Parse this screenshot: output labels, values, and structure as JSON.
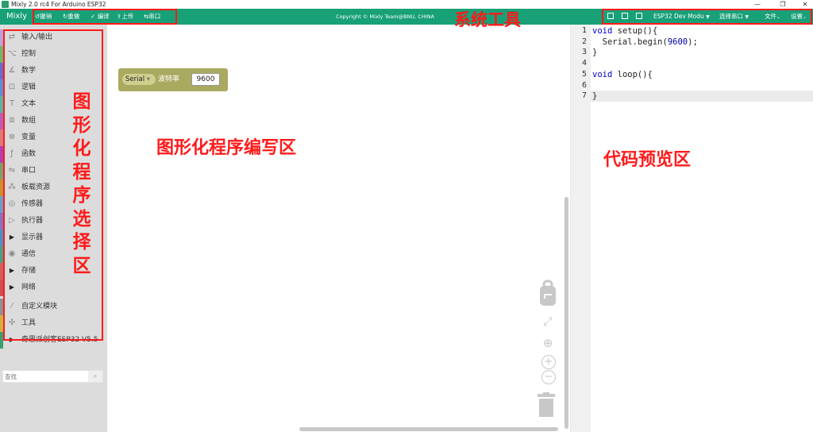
{
  "window": {
    "title": "Mixly 2.0 rc4 For Arduino ESP32",
    "controls": [
      "—",
      "❐",
      "✕"
    ]
  },
  "toolbar": {
    "brand": "Mixly",
    "buttons": [
      {
        "icon": "↺",
        "label": "撤销"
      },
      {
        "icon": "↻",
        "label": "重做"
      },
      {
        "icon": "✓",
        "label": "编译"
      },
      {
        "icon": "⇪",
        "label": "上传"
      },
      {
        "icon": "⇆",
        "label": "串口"
      }
    ],
    "copyright": "Copyright © Mixly Team@BNU, CHINA",
    "board": "ESP32 Dev Modu",
    "port": "选择串口",
    "file_menu": "文件",
    "settings_menu": "设置",
    "caret": "▼"
  },
  "annotations": {
    "system_tools": "系统工具",
    "palette": "图形化程序选择区",
    "workspace": "图形化程序编写区",
    "code_preview": "代码预览区"
  },
  "palette": {
    "categories": [
      {
        "label": "输入/输出",
        "icon": "⇄",
        "color": "#b8a4d8"
      },
      {
        "label": "控制",
        "icon": "⌥",
        "color": "#6eb56e"
      },
      {
        "label": "数学",
        "icon": "∡",
        "color": "#6a6ad0"
      },
      {
        "label": "逻辑",
        "icon": "⊡",
        "color": "#5b8fd3"
      },
      {
        "label": "文本",
        "icon": "T",
        "color": "#5ab5a0"
      },
      {
        "label": "数组",
        "icon": "≣",
        "color": "#b85fb8"
      },
      {
        "label": "变量",
        "icon": "⊗",
        "color": "#d87a7a"
      },
      {
        "label": "函数",
        "icon": "ƒ",
        "color": "#b040b0"
      },
      {
        "label": "串口",
        "icon": "⇋",
        "color": "#7aa070"
      },
      {
        "label": "板载资源",
        "icon": "⁂",
        "color": "#c89030"
      },
      {
        "label": "传感器",
        "icon": "◎",
        "color": "#6aa0c8"
      },
      {
        "label": "执行器",
        "icon": "▷",
        "color": "#8a70c0"
      },
      {
        "label": "显示器",
        "icon": "▶",
        "color": "#4a90c8"
      },
      {
        "label": "通信",
        "icon": "◉",
        "color": "#4aa080"
      },
      {
        "label": "存储",
        "icon": "▶",
        "color": "#d06060"
      },
      {
        "label": "网络",
        "icon": "▶",
        "color": "#c85050"
      },
      {
        "label": "自定义模块",
        "icon": "⁄",
        "color": "#909090"
      },
      {
        "label": "工具",
        "icon": "✣",
        "color": "#d0b040"
      },
      {
        "label": "奇思派创客ESP32-V5.5",
        "icon": "▶",
        "color": "#3aa070"
      }
    ],
    "search_placeholder": "查找",
    "search_icon": "⌕"
  },
  "workspace": {
    "block": {
      "dropdown": "Serial",
      "dropdown_caret": "▾",
      "label": "波特率",
      "value": "9600"
    },
    "icons": {
      "backpack": "backpack-icon",
      "zoom_reset": "⤢",
      "center": "⊕",
      "zoom_in": "+",
      "zoom_out": "−",
      "trash": "trash-icon"
    }
  },
  "code": {
    "line_numbers": [
      "1",
      "2",
      "3",
      "4",
      "5",
      "6",
      "7"
    ],
    "lines": [
      [
        "void",
        " setup(){"
      ],
      [
        "",
        "  Serial.begin(9600);"
      ],
      [
        "",
        "}"
      ],
      [
        "",
        ""
      ],
      [
        "void",
        " loop(){"
      ],
      [
        "",
        ""
      ],
      [
        "",
        "}"
      ]
    ],
    "active_line": 7
  },
  "colors": {
    "toolbar": "#18a077",
    "annotation": "#ff1a1a",
    "block": "#aaa960"
  }
}
